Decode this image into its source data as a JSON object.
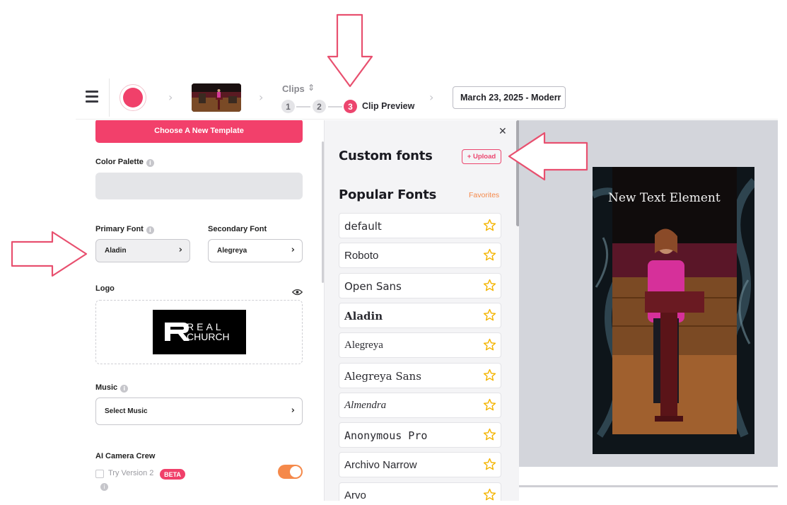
{
  "header": {
    "clips_label": "Clips",
    "steps": [
      "1",
      "2",
      "3"
    ],
    "current_step_label": "Clip Preview",
    "date_dropdown": "March 23, 2025 - Moderr"
  },
  "settings": {
    "template_button": "Choose A New Template",
    "color_palette_label": "Color Palette",
    "primary_font_label": "Primary Font",
    "primary_font_value": "Aladin",
    "secondary_font_label": "Secondary Font",
    "secondary_font_value": "Alegreya",
    "logo_label": "Logo",
    "logo_text_top": "REAL",
    "logo_text_bottom": "CHURCH",
    "music_label": "Music",
    "music_value": "Select Music",
    "camera_label": "AI Camera Crew",
    "try_version_label": "Try Version 2",
    "beta_badge": "BETA"
  },
  "font_panel": {
    "custom_title": "Custom fonts",
    "upload_button": "+ Upload",
    "popular_title": "Popular Fonts",
    "favorites_link": "Favorites",
    "fonts": [
      "default",
      "Roboto",
      "Open Sans",
      "Aladin",
      "Alegreya",
      "Alegreya Sans",
      "Almendra",
      "Anonymous Pro",
      "Archivo Narrow",
      "Arvo"
    ]
  },
  "preview": {
    "overlay_text": "New Text Element"
  },
  "colors": {
    "accent": "#f0406a",
    "toggle": "#f5894a",
    "star": "#f4b400",
    "annotation": "#e8506f"
  },
  "icons": [
    "hamburger-icon",
    "record-icon",
    "chevron-right-icon",
    "sort-icon",
    "info-icon",
    "eye-icon",
    "close-icon",
    "star-icon"
  ]
}
